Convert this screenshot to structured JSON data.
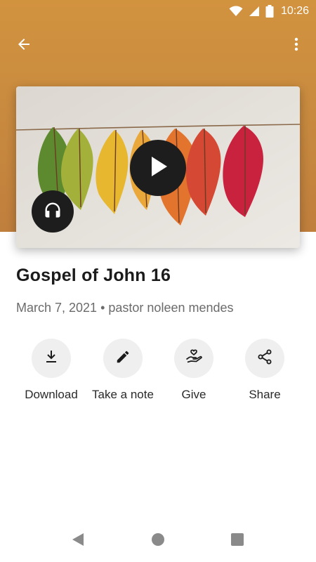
{
  "status_bar": {
    "time": "10:26",
    "icons": [
      "wifi-icon",
      "signal-icon",
      "battery-icon"
    ]
  },
  "toolbar": {
    "back_icon": "arrow-left-icon",
    "more_icon": "more-vert-icon"
  },
  "colors": {
    "header": "#c98b3f",
    "button_dark": "#1d1d1d",
    "action_circle": "#efefef",
    "title": "#1b1b1b",
    "meta": "#6b6b6b"
  },
  "media": {
    "play_icon": "play-icon",
    "audio_icon": "headphones-icon"
  },
  "sermon": {
    "title": "Gospel of John 16",
    "date": "March 7, 2021",
    "separator": "•",
    "speaker": "pastor noleen mendes"
  },
  "actions": [
    {
      "label": "Download",
      "icon": "download-icon"
    },
    {
      "label": "Take a note",
      "icon": "pencil-icon"
    },
    {
      "label": "Give",
      "icon": "give-heart-hand-icon"
    },
    {
      "label": "Share",
      "icon": "share-icon"
    }
  ],
  "nav_bar": {
    "icons": [
      "back-triangle-icon",
      "home-circle-icon",
      "recents-square-icon"
    ]
  }
}
